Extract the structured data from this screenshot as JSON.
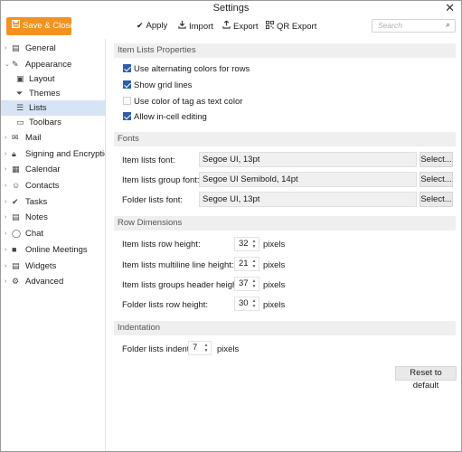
{
  "window": {
    "title": "Settings",
    "close_icon": "close-icon"
  },
  "toolbar": {
    "save_close_label": "Save & Close",
    "apply_label": "Apply",
    "import_label": "Import",
    "export_label": "Export",
    "qr_export_label": "QR Export",
    "search_placeholder": "Search",
    "accent_color": "#f39220"
  },
  "sidebar": {
    "items": [
      {
        "label": "General",
        "icon": "general-icon"
      },
      {
        "label": "Appearance",
        "icon": "appearance-icon",
        "expanded": true
      },
      {
        "label": "Layout",
        "icon": "layout-icon"
      },
      {
        "label": "Themes",
        "icon": "themes-icon"
      },
      {
        "label": "Lists",
        "icon": "lists-icon",
        "selected": true
      },
      {
        "label": "Toolbars",
        "icon": "toolbars-icon"
      },
      {
        "label": "Mail",
        "icon": "mail-icon"
      },
      {
        "label": "Signing and Encryption",
        "icon": "lock-icon"
      },
      {
        "label": "Calendar",
        "icon": "calendar-icon"
      },
      {
        "label": "Contacts",
        "icon": "contacts-icon"
      },
      {
        "label": "Tasks",
        "icon": "tasks-icon"
      },
      {
        "label": "Notes",
        "icon": "notes-icon"
      },
      {
        "label": "Chat",
        "icon": "chat-icon"
      },
      {
        "label": "Online Meetings",
        "icon": "video-icon"
      },
      {
        "label": "Widgets",
        "icon": "widgets-icon"
      },
      {
        "label": "Advanced",
        "icon": "gear-icon"
      }
    ],
    "selected_color": "#d6e4f5"
  },
  "item_lists": {
    "header": "Item Lists Properties",
    "alternating": {
      "label": "Use alternating colors for rows",
      "checked": true
    },
    "grid": {
      "label": "Show grid lines",
      "checked": true
    },
    "tag_color": {
      "label": "Use color of tag as text color",
      "checked": false
    },
    "in_cell": {
      "label": "Allow in-cell editing",
      "checked": true
    }
  },
  "fonts": {
    "header": "Fonts",
    "select_label": "Select...",
    "rows": [
      {
        "label": "Item lists font:",
        "value": "Segoe UI, 13pt"
      },
      {
        "label": "Item lists group font:",
        "value": "Segoe UI Semibold, 14pt"
      },
      {
        "label": "Folder lists font:",
        "value": "Segoe UI, 13pt"
      }
    ]
  },
  "row_dims": {
    "header": "Row Dimensions",
    "unit": "pixels",
    "rows": [
      {
        "label": "Item lists row height:",
        "value": "32"
      },
      {
        "label": "Item lists multiline line height:",
        "value": "21"
      },
      {
        "label": "Item lists groups header height:",
        "value": "37"
      },
      {
        "label": "Folder lists row height:",
        "value": "30"
      }
    ]
  },
  "indentation": {
    "header": "Indentation",
    "label": "Folder lists indent:",
    "value": "7",
    "unit": "pixels"
  },
  "reset_label": "Reset to default"
}
